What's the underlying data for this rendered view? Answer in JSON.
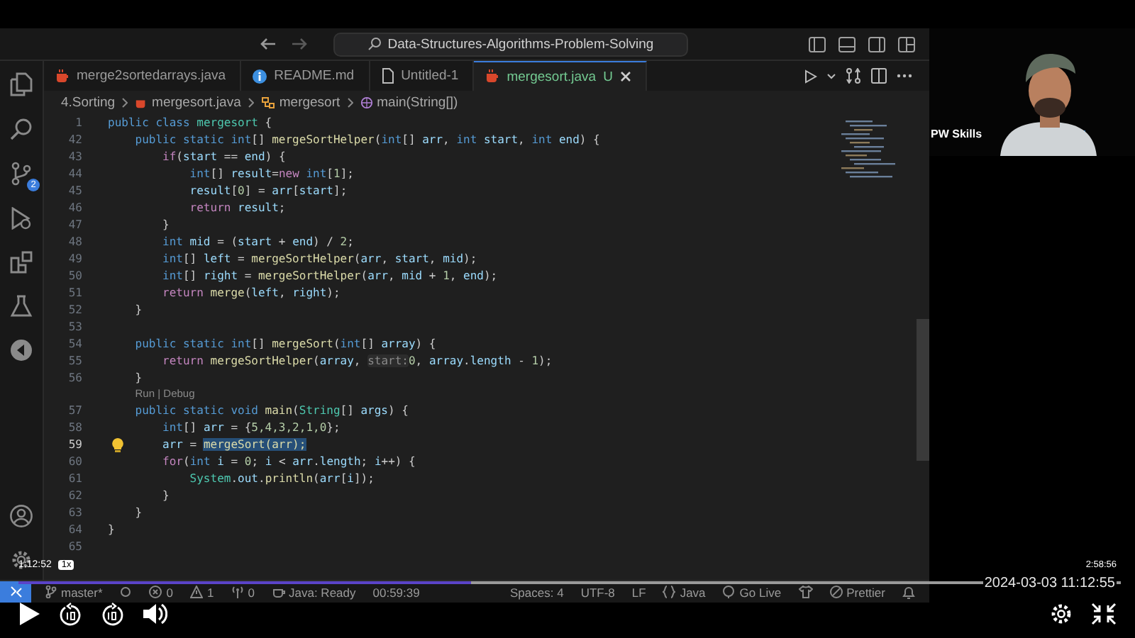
{
  "titlebar": {
    "search": "Data-Structures-Algorithms-Problem-Solving"
  },
  "activity_bar": {
    "badge": "2"
  },
  "tabs": [
    {
      "label": "merge2sortedarrays.java",
      "kind": "java",
      "selected": false
    },
    {
      "label": "README.md",
      "kind": "info",
      "selected": false
    },
    {
      "label": "Untitled-1",
      "kind": "file",
      "selected": false
    },
    {
      "label": "mergesort.java",
      "kind": "java",
      "selected": true,
      "git_status": "U"
    }
  ],
  "breadcrumb": [
    {
      "label": "4.Sorting",
      "kind": "folder"
    },
    {
      "label": "mergesort.java",
      "kind": "java"
    },
    {
      "label": "mergesort",
      "kind": "class"
    },
    {
      "label": "main(String[])",
      "kind": "method"
    }
  ],
  "lines": [
    {
      "n": "1",
      "kind": "code",
      "tokens": [
        {
          "kind": "mod",
          "text": "public class "
        },
        {
          "kind": "cls",
          "text": "mergesort"
        },
        {
          "kind": "p",
          "text": " {"
        }
      ],
      "children": [
        {
          "n": "42",
          "kind": "code",
          "tokens": [
            {
              "kind": "mod",
              "text": "public static "
            },
            {
              "kind": "type",
              "text": "int"
            },
            {
              "kind": "p",
              "text": "[] "
            },
            {
              "kind": "fn",
              "text": "mergeSortHelper"
            },
            {
              "kind": "p",
              "text": "("
            },
            {
              "kind": "type",
              "text": "int"
            },
            {
              "kind": "p",
              "text": "[] "
            },
            {
              "kind": "var",
              "text": "arr"
            },
            {
              "kind": "p",
              "text": ", "
            },
            {
              "kind": "type",
              "text": "int "
            },
            {
              "kind": "var",
              "text": "start"
            },
            {
              "kind": "p",
              "text": ", "
            },
            {
              "kind": "type",
              "text": "int "
            },
            {
              "kind": "var",
              "text": "end"
            },
            {
              "kind": "p",
              "text": ") {"
            }
          ],
          "children": [
            {
              "n": "43",
              "kind": "code",
              "tokens": [
                {
                  "kind": "ctl",
                  "text": "if"
                },
                {
                  "kind": "p",
                  "text": "("
                },
                {
                  "kind": "var",
                  "text": "start"
                },
                {
                  "kind": "p",
                  "text": " == "
                },
                {
                  "kind": "var",
                  "text": "end"
                },
                {
                  "kind": "p",
                  "text": ") {"
                }
              ],
              "children": [
                {
                  "n": "44",
                  "kind": "code",
                  "tokens": [
                    {
                      "kind": "type",
                      "text": "int"
                    },
                    {
                      "kind": "p",
                      "text": "[] "
                    },
                    {
                      "kind": "var",
                      "text": "result"
                    },
                    {
                      "kind": "p",
                      "text": "="
                    },
                    {
                      "kind": "ctl",
                      "text": "new "
                    },
                    {
                      "kind": "type",
                      "text": "int"
                    },
                    {
                      "kind": "p",
                      "text": "["
                    },
                    {
                      "kind": "num",
                      "text": "1"
                    },
                    {
                      "kind": "p",
                      "text": "];"
                    }
                  ]
                },
                {
                  "n": "45",
                  "kind": "code",
                  "tokens": [
                    {
                      "kind": "var",
                      "text": "result"
                    },
                    {
                      "kind": "p",
                      "text": "["
                    },
                    {
                      "kind": "num",
                      "text": "0"
                    },
                    {
                      "kind": "p",
                      "text": "] = "
                    },
                    {
                      "kind": "var",
                      "text": "arr"
                    },
                    {
                      "kind": "p",
                      "text": "["
                    },
                    {
                      "kind": "var",
                      "text": "start"
                    },
                    {
                      "kind": "p",
                      "text": "];"
                    }
                  ]
                },
                {
                  "n": "46",
                  "kind": "code",
                  "tokens": [
                    {
                      "kind": "ctl",
                      "text": "return "
                    },
                    {
                      "kind": "var",
                      "text": "result"
                    },
                    {
                      "kind": "p",
                      "text": ";"
                    }
                  ]
                }
              ]
            },
            {
              "n": "47",
              "kind": "code",
              "tokens": [
                {
                  "kind": "p",
                  "text": "}"
                }
              ]
            },
            {
              "n": "48",
              "kind": "code",
              "tokens": [
                {
                  "kind": "type",
                  "text": "int "
                },
                {
                  "kind": "var",
                  "text": "mid"
                },
                {
                  "kind": "p",
                  "text": " = ("
                },
                {
                  "kind": "var",
                  "text": "start"
                },
                {
                  "kind": "p",
                  "text": " + "
                },
                {
                  "kind": "var",
                  "text": "end"
                },
                {
                  "kind": "p",
                  "text": ") / "
                },
                {
                  "kind": "num",
                  "text": "2"
                },
                {
                  "kind": "p",
                  "text": ";"
                }
              ]
            },
            {
              "n": "49",
              "kind": "code",
              "tokens": [
                {
                  "kind": "type",
                  "text": "int"
                },
                {
                  "kind": "p",
                  "text": "[] "
                },
                {
                  "kind": "var",
                  "text": "left"
                },
                {
                  "kind": "p",
                  "text": " = "
                },
                {
                  "kind": "fn",
                  "text": "mergeSortHelper"
                },
                {
                  "kind": "p",
                  "text": "("
                },
                {
                  "kind": "var",
                  "text": "arr"
                },
                {
                  "kind": "p",
                  "text": ", "
                },
                {
                  "kind": "var",
                  "text": "start"
                },
                {
                  "kind": "p",
                  "text": ", "
                },
                {
                  "kind": "var",
                  "text": "mid"
                },
                {
                  "kind": "p",
                  "text": ");"
                }
              ]
            },
            {
              "n": "50",
              "kind": "code",
              "tokens": [
                {
                  "kind": "type",
                  "text": "int"
                },
                {
                  "kind": "p",
                  "text": "[] "
                },
                {
                  "kind": "var",
                  "text": "right"
                },
                {
                  "kind": "p",
                  "text": " = "
                },
                {
                  "kind": "fn",
                  "text": "mergeSortHelper"
                },
                {
                  "kind": "p",
                  "text": "("
                },
                {
                  "kind": "var",
                  "text": "arr"
                },
                {
                  "kind": "p",
                  "text": ", "
                },
                {
                  "kind": "var",
                  "text": "mid"
                },
                {
                  "kind": "p",
                  "text": " + "
                },
                {
                  "kind": "num",
                  "text": "1"
                },
                {
                  "kind": "p",
                  "text": ", "
                },
                {
                  "kind": "var",
                  "text": "end"
                },
                {
                  "kind": "p",
                  "text": ");"
                }
              ]
            },
            {
              "n": "51",
              "kind": "code",
              "tokens": [
                {
                  "kind": "ctl",
                  "text": "return "
                },
                {
                  "kind": "fn",
                  "text": "merge"
                },
                {
                  "kind": "p",
                  "text": "("
                },
                {
                  "kind": "var",
                  "text": "left"
                },
                {
                  "kind": "p",
                  "text": ", "
                },
                {
                  "kind": "var",
                  "text": "right"
                },
                {
                  "kind": "p",
                  "text": ");"
                }
              ]
            }
          ]
        },
        {
          "n": "52",
          "kind": "code",
          "tokens": [
            {
              "kind": "p",
              "text": "}"
            }
          ]
        },
        {
          "n": "53",
          "kind": "code"
        },
        {
          "n": "54",
          "kind": "code",
          "tokens": [
            {
              "kind": "mod",
              "text": "public static "
            },
            {
              "kind": "type",
              "text": "int"
            },
            {
              "kind": "p",
              "text": "[] "
            },
            {
              "kind": "fn",
              "text": "mergeSort"
            },
            {
              "kind": "p",
              "text": "("
            },
            {
              "kind": "type",
              "text": "int"
            },
            {
              "kind": "p",
              "text": "[] "
            },
            {
              "kind": "var",
              "text": "array"
            },
            {
              "kind": "p",
              "text": ") {"
            }
          ],
          "children": [
            {
              "n": "55",
              "kind": "code",
              "tokens": [
                {
                  "kind": "ctl",
                  "text": "return "
                },
                {
                  "kind": "fn",
                  "text": "mergeSortHelper"
                },
                {
                  "kind": "p",
                  "text": "("
                },
                {
                  "kind": "var",
                  "text": "array"
                },
                {
                  "kind": "p",
                  "text": ", "
                },
                {
                  "kind": "hint",
                  "text": "start:"
                },
                {
                  "kind": "num",
                  "text": "0"
                },
                {
                  "kind": "p",
                  "text": ", "
                },
                {
                  "kind": "var",
                  "text": "array"
                },
                {
                  "kind": "p",
                  "text": "."
                },
                {
                  "kind": "var",
                  "text": "length"
                },
                {
                  "kind": "p",
                  "text": " - "
                },
                {
                  "kind": "num",
                  "text": "1"
                },
                {
                  "kind": "p",
                  "text": ");"
                }
              ]
            }
          ]
        },
        {
          "n": "56",
          "kind": "code",
          "tokens": [
            {
              "kind": "p",
              "text": "}"
            }
          ]
        },
        {
          "kind": "lens",
          "tokens": [
            {
              "kind": "lens",
              "text": "Run"
            },
            {
              "kind": "lens",
              "text": " | "
            },
            {
              "kind": "lens",
              "text": "Debug"
            }
          ]
        },
        {
          "n": "57",
          "kind": "code",
          "tokens": [
            {
              "kind": "mod",
              "text": "public static void "
            },
            {
              "kind": "fn",
              "text": "main"
            },
            {
              "kind": "p",
              "text": "("
            },
            {
              "kind": "cls",
              "text": "String"
            },
            {
              "kind": "p",
              "text": "[] "
            },
            {
              "kind": "var",
              "text": "args"
            },
            {
              "kind": "p",
              "text": ") {"
            }
          ],
          "children": [
            {
              "n": "58",
              "kind": "code",
              "tokens": [
                {
                  "kind": "type",
                  "text": "int"
                },
                {
                  "kind": "p",
                  "text": "[] "
                },
                {
                  "kind": "var",
                  "text": "arr"
                },
                {
                  "kind": "p",
                  "text": " = {"
                },
                {
                  "kind": "num",
                  "text": "5,4,3,2,1,0"
                },
                {
                  "kind": "p",
                  "text": "};"
                }
              ]
            },
            {
              "n": "59",
              "kind": "active",
              "tokens": [
                {
                  "kind": "var",
                  "text": "arr"
                },
                {
                  "kind": "p",
                  "text": " = "
                },
                {
                  "kind": "sel",
                  "text": "mergeSort(arr);"
                }
              ]
            },
            {
              "n": "60",
              "kind": "code",
              "tokens": [
                {
                  "kind": "ctl",
                  "text": "for"
                },
                {
                  "kind": "p",
                  "text": "("
                },
                {
                  "kind": "type",
                  "text": "int "
                },
                {
                  "kind": "var",
                  "text": "i"
                },
                {
                  "kind": "p",
                  "text": " = "
                },
                {
                  "kind": "num",
                  "text": "0"
                },
                {
                  "kind": "p",
                  "text": "; "
                },
                {
                  "kind": "var",
                  "text": "i"
                },
                {
                  "kind": "p",
                  "text": " < "
                },
                {
                  "kind": "var",
                  "text": "arr"
                },
                {
                  "kind": "p",
                  "text": "."
                },
                {
                  "kind": "var",
                  "text": "length"
                },
                {
                  "kind": "p",
                  "text": "; "
                },
                {
                  "kind": "var",
                  "text": "i"
                },
                {
                  "kind": "p",
                  "text": "++) {"
                }
              ],
              "children": [
                {
                  "n": "61",
                  "kind": "code",
                  "tokens": [
                    {
                      "kind": "cls",
                      "text": "System"
                    },
                    {
                      "kind": "p",
                      "text": "."
                    },
                    {
                      "kind": "var",
                      "text": "out"
                    },
                    {
                      "kind": "p",
                      "text": "."
                    },
                    {
                      "kind": "fn",
                      "text": "println"
                    },
                    {
                      "kind": "p",
                      "text": "("
                    },
                    {
                      "kind": "var",
                      "text": "arr"
                    },
                    {
                      "kind": "p",
                      "text": "["
                    },
                    {
                      "kind": "var",
                      "text": "i"
                    },
                    {
                      "kind": "p",
                      "text": "]);"
                    }
                  ]
                }
              ]
            },
            {
              "n": "62",
              "kind": "code",
              "tokens": [
                {
                  "kind": "p",
                  "text": "}"
                }
              ]
            }
          ]
        },
        {
          "n": "63",
          "kind": "code",
          "tokens": [
            {
              "kind": "p",
              "text": "}"
            }
          ]
        }
      ]
    },
    {
      "n": "64",
      "kind": "code",
      "tokens": [
        {
          "kind": "p",
          "text": "}"
        }
      ]
    },
    {
      "n": "65",
      "kind": "code"
    }
  ],
  "status_left": [
    {
      "kind": "branch",
      "text": "master*"
    },
    {
      "kind": "sync"
    },
    {
      "kind": "errors",
      "text": "0"
    },
    {
      "kind": "warnings",
      "text": "1"
    },
    {
      "kind": "ports",
      "text": "0"
    },
    {
      "kind": "java",
      "text": "Java: Ready"
    },
    {
      "kind": "plain",
      "text": "00:59:39"
    }
  ],
  "status_right": [
    {
      "kind": "plain",
      "text": "Spaces: 4"
    },
    {
      "kind": "plain",
      "text": "UTF-8"
    },
    {
      "kind": "plain",
      "text": "LF"
    },
    {
      "kind": "braces",
      "text": "Java"
    },
    {
      "kind": "golive",
      "text": "Go Live"
    },
    {
      "kind": "shirt"
    },
    {
      "kind": "prettier",
      "text": "Prettier"
    },
    {
      "kind": "bell"
    }
  ],
  "webcam": {
    "kind": "picture",
    "label": "PW Skills"
  },
  "video": {
    "elapsed": "1:12:52",
    "speed": "1x",
    "duration": "2:58:56",
    "timestamp": "2024-03-03 11:12:55",
    "level": 0.41,
    "playing": false
  }
}
